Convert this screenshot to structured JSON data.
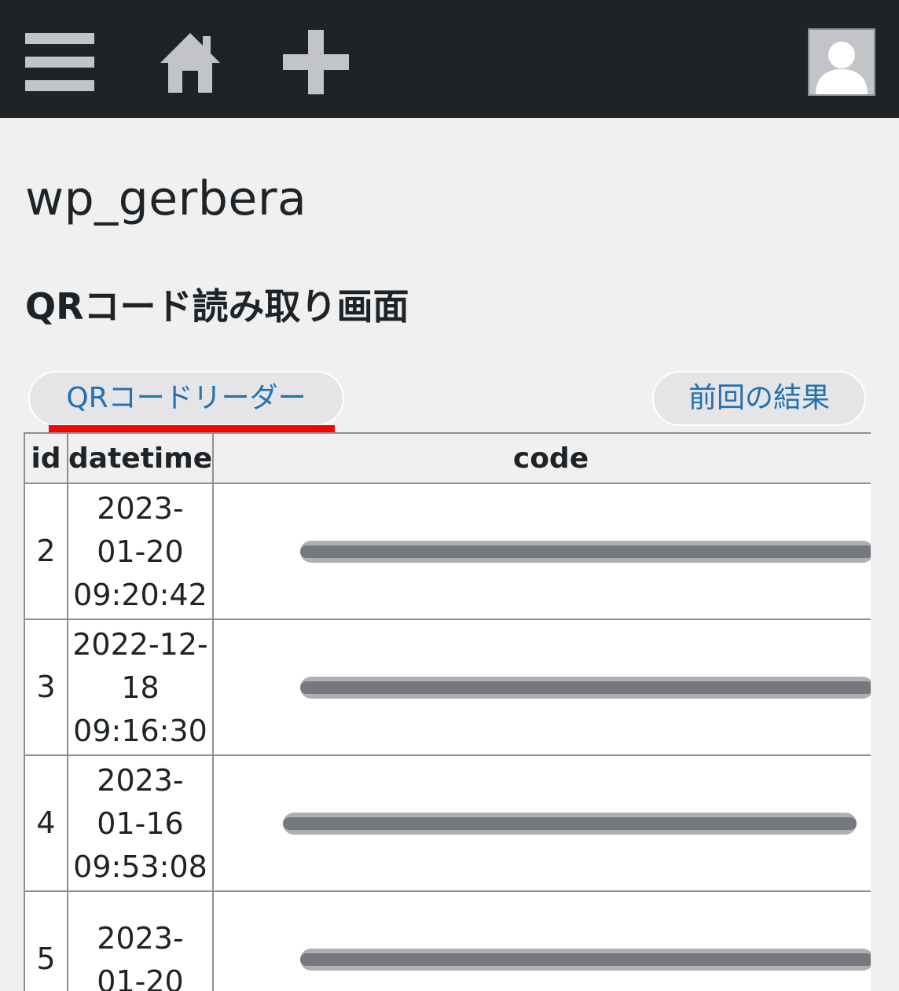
{
  "header": {
    "menu_icon": "hamburger-menu-icon",
    "home_icon": "home-icon",
    "add_icon": "plus-icon",
    "avatar_icon": "user-avatar-icon"
  },
  "site_title": "wp_gerbera",
  "page_heading": "QRコード読み取り画面",
  "buttons": {
    "qr_reader": "QRコードリーダー",
    "previous_result": "前回の結果"
  },
  "table": {
    "headers": [
      "id",
      "datetime",
      "code"
    ],
    "rows": [
      {
        "id": "2",
        "datetime_lines": [
          "2023-",
          "01-20",
          "09:20:42"
        ]
      },
      {
        "id": "3",
        "datetime_lines": [
          "2022-12-",
          "18",
          "09:16:30"
        ]
      },
      {
        "id": "4",
        "datetime_lines": [
          "2023-",
          "01-16",
          "09:53:08"
        ]
      },
      {
        "id": "5",
        "datetime_lines": [
          "2023-",
          "01-20",
          ""
        ]
      }
    ]
  },
  "colors": {
    "topbar": "#1d2327",
    "link": "#2271b1",
    "highlight_underline": "#ff0000"
  }
}
